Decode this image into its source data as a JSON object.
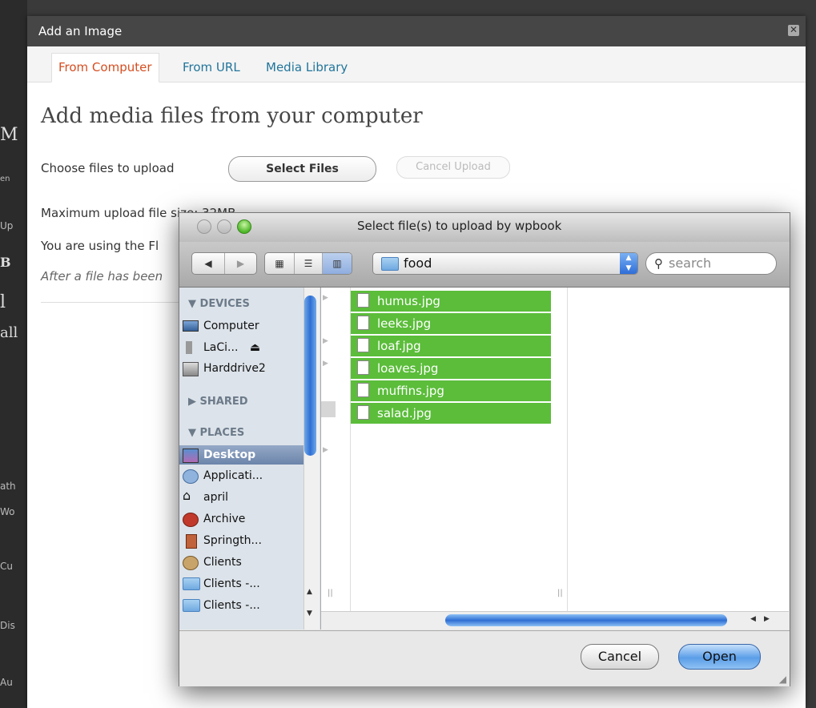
{
  "background": {
    "fragments": [
      "M",
      "en",
      "Up",
      "B",
      "l",
      "all",
      "ath",
      "Wo",
      "Cu",
      "Dis",
      "Au"
    ]
  },
  "modal": {
    "title": "Add an Image",
    "close_icon": "close-icon",
    "tabs": [
      {
        "label": "From Computer",
        "active": true
      },
      {
        "label": "From URL",
        "active": false
      },
      {
        "label": "Media Library",
        "active": false
      }
    ],
    "heading": "Add media files from your computer",
    "choose_label": "Choose files to upload",
    "select_files_label": "Select Files",
    "cancel_upload_label": "Cancel Upload",
    "max_size_text": "Maximum upload file size: 32MB.",
    "using_text": "You are using the Fl",
    "after_text": "After a file has been"
  },
  "dialog": {
    "title": "Select file(s) to upload by wpbook",
    "current_folder": "food",
    "search_placeholder": "search",
    "sidebar": {
      "devices_heading": "DEVICES",
      "devices": [
        "Computer",
        "LaCi...",
        "Harddrive2"
      ],
      "shared_heading": "SHARED",
      "places_heading": "PLACES",
      "places": [
        "Desktop",
        "Applicati...",
        "april",
        "Archive",
        "Springth...",
        "Clients",
        "Clients -...",
        "Clients -..."
      ],
      "selected_place": "Desktop"
    },
    "files": [
      "humus.jpg",
      "leeks.jpg",
      "loaf.jpg",
      "loaves.jpg",
      "muffins.jpg",
      "salad.jpg"
    ],
    "cancel_label": "Cancel",
    "open_label": "Open"
  },
  "colors": {
    "selection": "#5bbd3a",
    "link": "#21759b",
    "active_tab": "#d54e21"
  }
}
